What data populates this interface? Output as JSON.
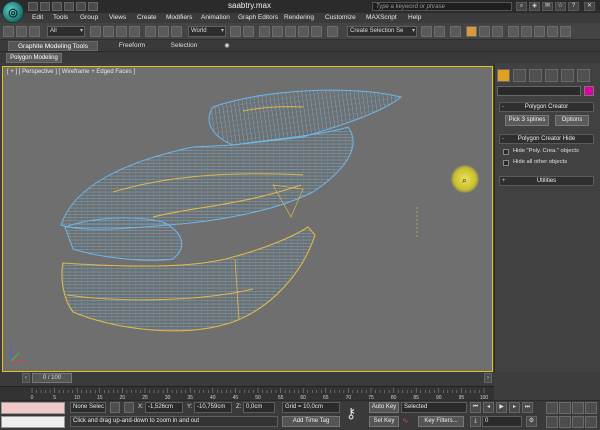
{
  "titlebar": {
    "title": "saabtry.max",
    "search_placeholder": "Type a keyword or phrase"
  },
  "menu": [
    "Edit",
    "Tools",
    "Group",
    "Views",
    "Create",
    "Modifiers",
    "Animation",
    "Graph Editors",
    "Rendering",
    "Customize",
    "MAXScript",
    "Help"
  ],
  "toolbar": {
    "filter_value": "All",
    "refcoord_value": "World",
    "selection_set_value": "Create Selection Se"
  },
  "ribbon": {
    "tabs": [
      "Graphite Modeling Tools",
      "Freeform",
      "Selection"
    ],
    "active_subtab": "Polygon Modeling"
  },
  "viewport": {
    "label": "[ + ] [ Perspective ] [ Wireframe + Edged Faces ]"
  },
  "command_panel": {
    "polygon_creator_title": "Polygon Creator",
    "pick_splines_label": "Pick 3 splines",
    "options_label": "Options",
    "hide_title": "Polygon Creator Hide",
    "hide_poly_label": "Hide \"Poly. Crea.\" objects",
    "hide_others_label": "Hide all other objects",
    "utilities_title": "Utilities"
  },
  "timeline": {
    "frame_display": "0 / 100",
    "ticks": [
      "0",
      "5",
      "10",
      "15",
      "20",
      "25",
      "30",
      "35",
      "40",
      "45",
      "50",
      "55",
      "60",
      "65",
      "70",
      "75",
      "80",
      "85",
      "90",
      "95",
      "100"
    ]
  },
  "status": {
    "selection_text": "None Selec",
    "x_label": "X:",
    "x_value": "-1,526cm",
    "y_label": "Y:",
    "y_value": "-10,759cm",
    "z_label": "Z:",
    "z_value": "0,0cm",
    "grid_text": "Grid = 10,0cm",
    "prompt_text": "Click and drag up-and-down to zoom in and out",
    "add_time_tag": "Add Time Tag",
    "auto_key": "Auto Key",
    "set_key": "Set Key",
    "key_selected": "Selected",
    "key_filters": "Key Filters...",
    "current_frame": "0"
  },
  "colors": {
    "viewport_border": "#e5c21a",
    "wire_blue": "#6fb7e6",
    "wire_yellow": "#e0b84a",
    "swatch": "#e000a0"
  }
}
